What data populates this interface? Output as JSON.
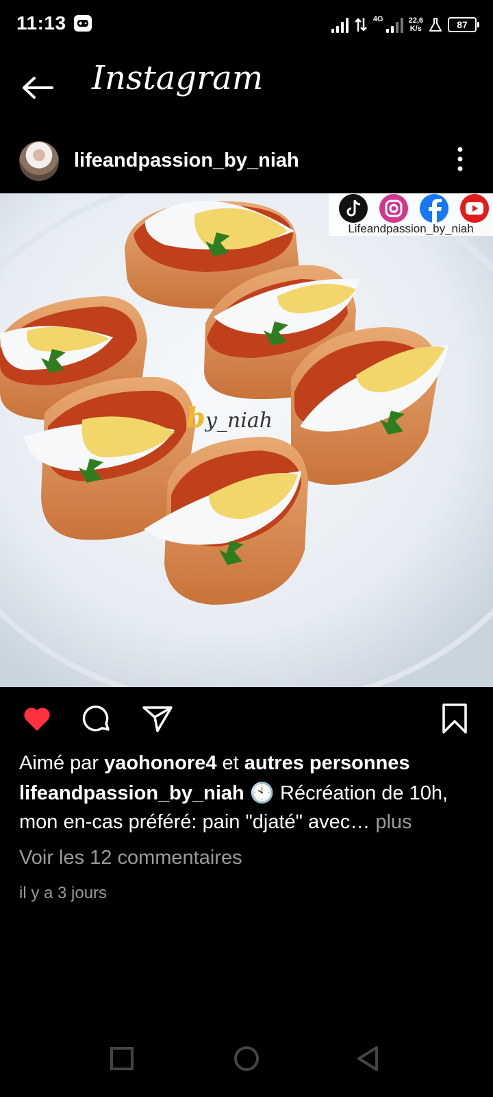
{
  "status_bar": {
    "time": "11:13",
    "network_type": "4G",
    "speed_value": "22,6",
    "speed_unit": "K/s",
    "battery": "87"
  },
  "header": {
    "title": "Instagram",
    "back_icon": "arrow-left-icon"
  },
  "post": {
    "username": "lifeandpassion_by_niah",
    "photo": {
      "watermark_text": "Lifeandpassion_by_niah",
      "overlay_text_b": "b",
      "overlay_text_rest": "y_niah",
      "social_icons": [
        "tiktok-icon",
        "instagram-icon",
        "facebook-icon",
        "youtube-icon"
      ]
    },
    "liked": true,
    "likes": {
      "prefix": "Aimé par",
      "user": "yaohonore4",
      "middle": "et",
      "suffix": "autres personnes"
    },
    "caption": {
      "username": "lifeandpassion_by_niah",
      "emoji": "🕙",
      "text": "Récréation de 10h, mon en-cas préféré: pain \"djaté\" avec…",
      "more": "plus"
    },
    "comments_link": "Voir les 12 commentaires",
    "timestamp": "il y a 3 jours"
  },
  "colors": {
    "background": "#000000",
    "like_red": "#ff3040",
    "secondary_text": "#9b9b9b"
  }
}
